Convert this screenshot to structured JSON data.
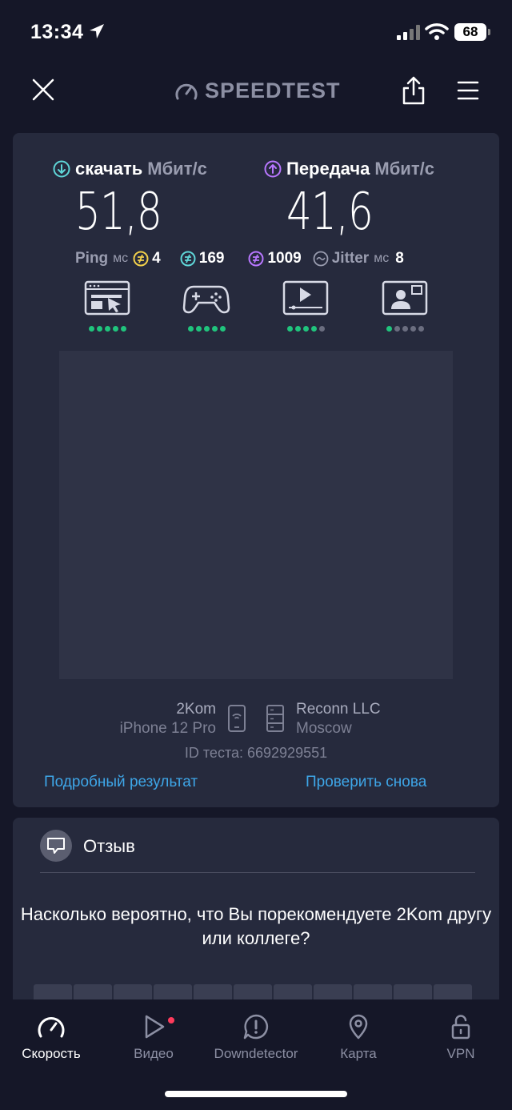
{
  "status_bar": {
    "time": "13:34",
    "battery": "68"
  },
  "header": {
    "brand": "SPEEDTEST"
  },
  "download": {
    "label": "скачать",
    "unit": "Мбит/с",
    "value": "51,8"
  },
  "upload": {
    "label": "Передача",
    "unit": "Мбит/с",
    "value": "41,6"
  },
  "ping": {
    "label": "Ping",
    "unit": "мс",
    "idle": "4",
    "download": "169",
    "upload": "1009"
  },
  "jitter": {
    "label": "Jitter",
    "unit": "мс",
    "value": "8"
  },
  "quality": [
    {
      "icon": "web-browsing-icon",
      "rating": 5,
      "max": 5
    },
    {
      "icon": "gaming-icon",
      "rating": 5,
      "max": 5
    },
    {
      "icon": "video-streaming-icon",
      "rating": 4,
      "max": 5
    },
    {
      "icon": "video-call-icon",
      "rating": 1,
      "max": 5
    }
  ],
  "provider": {
    "name": "2Kom",
    "device": "iPhone 12 Pro"
  },
  "server": {
    "name": "Reconn LLC",
    "city": "Moscow"
  },
  "test_id": "ID теста: 6692929551",
  "links": {
    "details": "Подробный результат",
    "retry": "Проверить снова"
  },
  "feedback": {
    "title": "Отзыв",
    "question": "Насколько вероятно, что Вы порекомендуете 2Kom другу или коллеге?"
  },
  "tabs": [
    {
      "label": "Скорость",
      "icon": "speed-gauge-icon",
      "active": true
    },
    {
      "label": "Видео",
      "icon": "play-icon",
      "active": false
    },
    {
      "label": "Downdetector",
      "icon": "alert-icon",
      "active": false
    },
    {
      "label": "Карта",
      "icon": "map-pin-icon",
      "active": false
    },
    {
      "label": "VPN",
      "icon": "lock-icon",
      "active": false
    }
  ],
  "colors": {
    "background": "#151728",
    "card": "#262a3d",
    "download_accent": "#5fd6d8",
    "upload_accent": "#b877ff",
    "link": "#3ea6e8",
    "good": "#20c47d"
  }
}
